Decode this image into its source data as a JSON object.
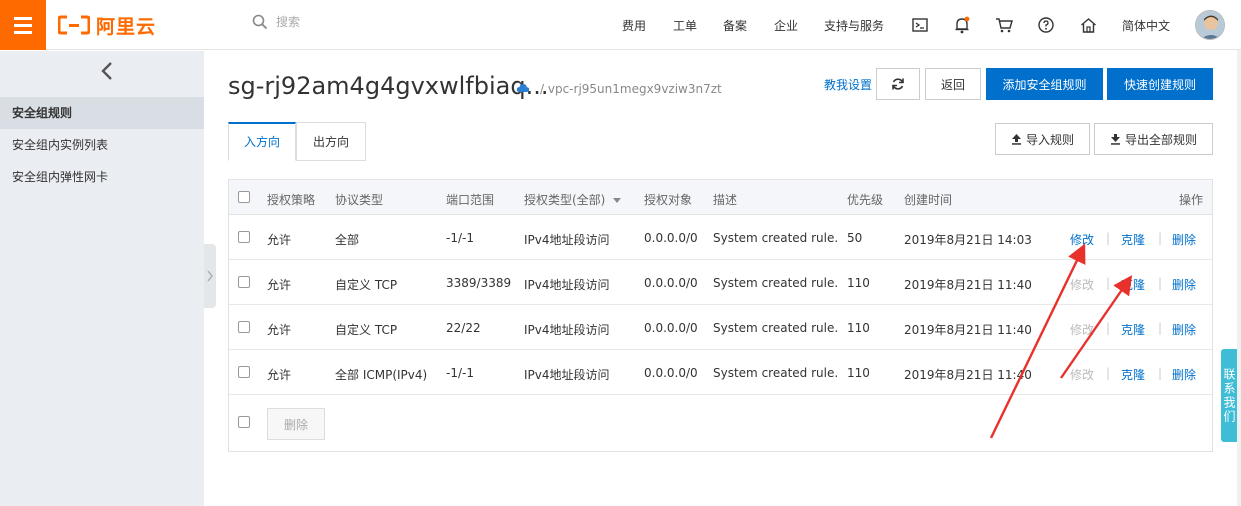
{
  "topbar": {
    "logo_text": "阿里云",
    "search_placeholder": "搜索",
    "nav": [
      "费用",
      "工单",
      "备案",
      "企业",
      "支持与服务"
    ],
    "language": "简体中文",
    "icons": [
      "terminal-icon",
      "bell-icon",
      "cart-icon",
      "help-icon",
      "home-icon"
    ]
  },
  "sidebar": {
    "items": [
      {
        "label": "安全组规则",
        "active": true
      },
      {
        "label": "安全组内实例列表",
        "active": false
      },
      {
        "label": "安全组内弹性网卡",
        "active": false
      }
    ]
  },
  "header": {
    "title": "sg-rj92am4g4gvxwlfbiaq...",
    "vpc": "/ vpc-rj95un1megx9vziw3n7zt",
    "help_link": "教我设置",
    "back_button": "返回",
    "add_rule_button": "添加安全组规则",
    "quick_rule_button": "快速创建规则"
  },
  "tabs": [
    {
      "label": "入方向",
      "active": true
    },
    {
      "label": "出方向",
      "active": false
    }
  ],
  "actions": {
    "import_label": "导入规则",
    "export_label": "导出全部规则"
  },
  "table": {
    "headers": {
      "policy": "授权策略",
      "protocol": "协议类型",
      "port": "端口范围",
      "auth_type": "授权类型(全部)",
      "auth_target": "授权对象",
      "desc": "描述",
      "priority": "优先级",
      "created": "创建时间",
      "ops": "操作"
    },
    "rows": [
      {
        "policy": "允许",
        "protocol": "全部",
        "port": "-1/-1",
        "auth_type": "IPv4地址段访问",
        "auth_target": "0.0.0.0/0",
        "desc": "System created rule.",
        "priority": "50",
        "created": "2019年8月21日 14:03",
        "edit": "修改",
        "clone": "克隆",
        "delete": "删除",
        "edit_enabled": true
      },
      {
        "policy": "允许",
        "protocol": "自定义 TCP",
        "port": "3389/3389",
        "auth_type": "IPv4地址段访问",
        "auth_target": "0.0.0.0/0",
        "desc": "System created rule.",
        "priority": "110",
        "created": "2019年8月21日 11:40",
        "edit": "修改",
        "clone": "克隆",
        "delete": "删除",
        "edit_enabled": false
      },
      {
        "policy": "允许",
        "protocol": "自定义 TCP",
        "port": "22/22",
        "auth_type": "IPv4地址段访问",
        "auth_target": "0.0.0.0/0",
        "desc": "System created rule.",
        "priority": "110",
        "created": "2019年8月21日 11:40",
        "edit": "修改",
        "clone": "克隆",
        "delete": "删除",
        "edit_enabled": false
      },
      {
        "policy": "允许",
        "protocol": "全部 ICMP(IPv4)",
        "port": "-1/-1",
        "auth_type": "IPv4地址段访问",
        "auth_target": "0.0.0.0/0",
        "desc": "System created rule.",
        "priority": "110",
        "created": "2019年8月21日 11:40",
        "edit": "修改",
        "clone": "克隆",
        "delete": "删除",
        "edit_enabled": false
      }
    ],
    "bulk_delete": "删除"
  },
  "contact": {
    "label": "联系我们"
  },
  "colors": {
    "brand": "#ff6a00",
    "primary": "#0070cc",
    "annotation": "#e8312b"
  }
}
